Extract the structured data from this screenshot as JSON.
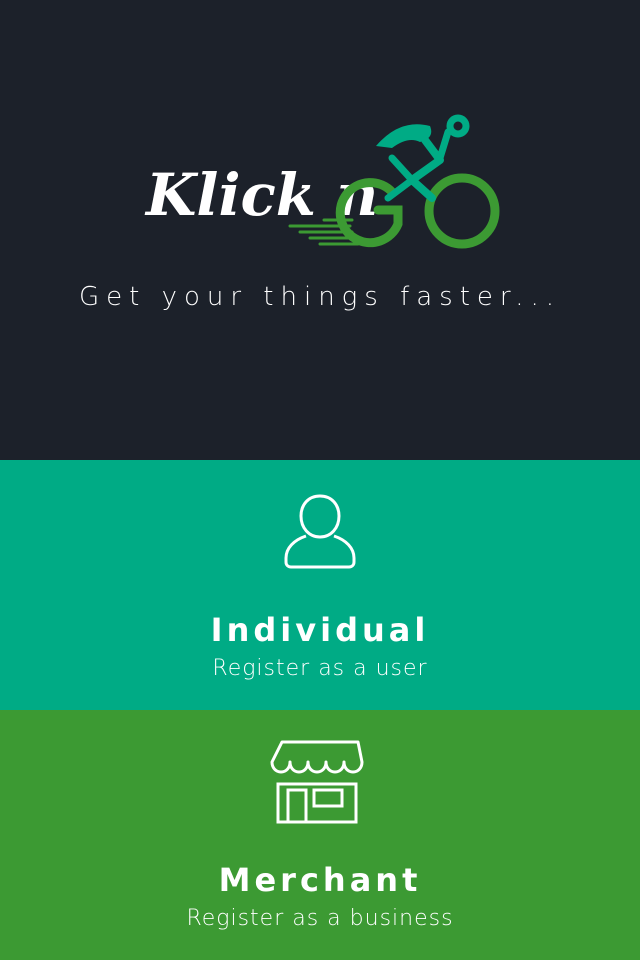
{
  "brand": {
    "logo_text": "Klick n",
    "logo_mark": "GO",
    "tagline": "Get your things faster...",
    "background_color": "#1c212a",
    "accent_teal": "#00ab85",
    "accent_green": "#3c9a33"
  },
  "options": {
    "individual": {
      "icon": "user-icon",
      "title": "Individual",
      "subtitle": "Register as a user",
      "color": "#00ab85"
    },
    "merchant": {
      "icon": "storefront-icon",
      "title": "Merchant",
      "subtitle": "Register as a business",
      "color": "#3c9a33"
    }
  }
}
